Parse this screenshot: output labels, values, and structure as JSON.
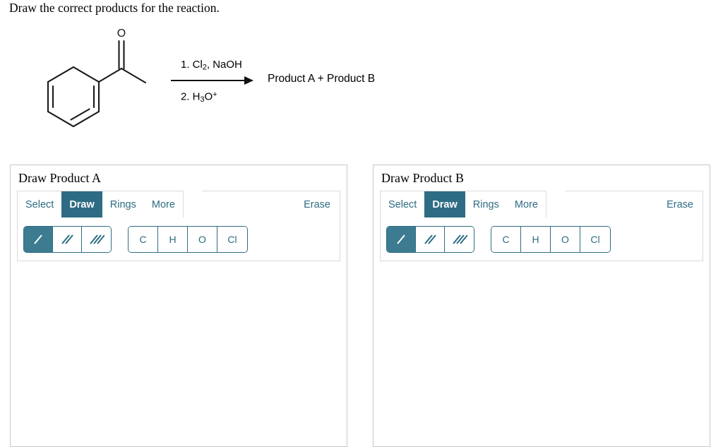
{
  "question": {
    "prompt": "Draw the correct products for the reaction."
  },
  "reaction": {
    "reactant_name": "acetophenone",
    "reactant_oxygen_label": "O",
    "reagent_step_1_prefix": "1. Cl",
    "reagent_step_1_sub": "2",
    "reagent_step_1_suffix": ", NaOH",
    "reagent_step_2_prefix": "2. H",
    "reagent_step_2_sub": "3",
    "reagent_step_2_mid": "O",
    "reagent_step_2_sup": "+",
    "products_label": "Product A  + Product B",
    "arrow": "reaction-arrow-right"
  },
  "panels": [
    {
      "heading": "Draw Product A",
      "tabs": [
        {
          "label": "Select",
          "active": false
        },
        {
          "label": "Draw",
          "active": true
        },
        {
          "label": "Rings",
          "active": false
        },
        {
          "label": "More",
          "active": false
        }
      ],
      "erase_label": "Erase",
      "bond_tools": [
        {
          "name": "single-bond",
          "glyph": "/",
          "selected": true
        },
        {
          "name": "double-bond",
          "glyph": "//",
          "selected": false
        },
        {
          "name": "triple-bond",
          "glyph": "///",
          "selected": false
        }
      ],
      "atom_tools": [
        {
          "label": "C"
        },
        {
          "label": "H"
        },
        {
          "label": "O"
        },
        {
          "label": "Cl"
        }
      ]
    },
    {
      "heading": "Draw Product B",
      "tabs": [
        {
          "label": "Select",
          "active": false
        },
        {
          "label": "Draw",
          "active": true
        },
        {
          "label": "Rings",
          "active": false
        },
        {
          "label": "More",
          "active": false
        }
      ],
      "erase_label": "Erase",
      "bond_tools": [
        {
          "name": "single-bond",
          "glyph": "/",
          "selected": true
        },
        {
          "name": "double-bond",
          "glyph": "//",
          "selected": false
        },
        {
          "name": "triple-bond",
          "glyph": "///",
          "selected": false
        }
      ],
      "atom_tools": [
        {
          "label": "C"
        },
        {
          "label": "H"
        },
        {
          "label": "O"
        },
        {
          "label": "Cl"
        }
      ]
    }
  ],
  "colors": {
    "accent_teal": "#2e6c83",
    "selected_teal": "#3d7b91",
    "panel_border": "#c8c8c8",
    "toolbar_border": "#dadada",
    "text_black": "#000000"
  }
}
